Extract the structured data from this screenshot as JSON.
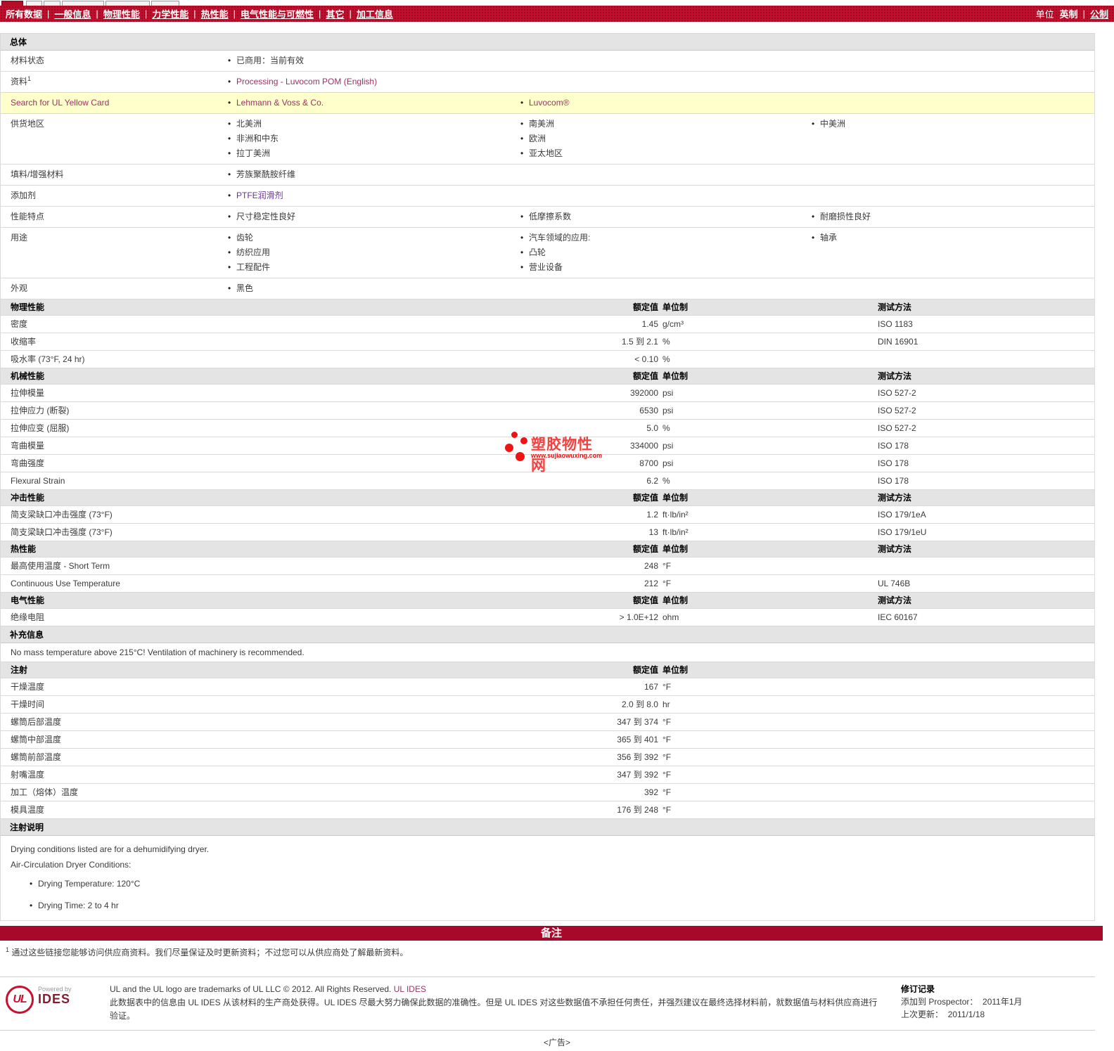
{
  "nav": {
    "tabs": [
      "所有数据",
      "一般信息",
      "物理性能",
      "力学性能",
      "热性能",
      "电气性能与可燃性",
      "其它",
      "加工信息"
    ],
    "units_label": "单位",
    "unit_imperial": "英制",
    "unit_metric": "公制"
  },
  "columns": {
    "value": "额定值",
    "unit": "单位制",
    "method": "测试方法"
  },
  "overview": {
    "title": "总体",
    "material_status": {
      "label": "材料状态",
      "v": "已商用：当前有效"
    },
    "literature": {
      "label": "资料",
      "sup": "1",
      "v": "Processing - Luvocom POM (English)"
    },
    "yellow_card": {
      "label": "Search for UL Yellow Card",
      "supplier": "Lehmann & Voss & Co.",
      "brand": "Luvocom®"
    },
    "availability": {
      "label": "供货地区",
      "c1": [
        "北美洲",
        "非洲和中东",
        "拉丁美洲"
      ],
      "c2": [
        "南美洲",
        "欧洲",
        "亚太地区"
      ],
      "c3": [
        "中美洲"
      ]
    },
    "filler": {
      "label": "填料/增强材料",
      "v": "芳族聚酰胺纤维"
    },
    "additive": {
      "label": "添加剂",
      "v": "PTFE润滑剂"
    },
    "features": {
      "label": "性能特点",
      "c1": [
        "尺寸稳定性良好"
      ],
      "c2": [
        "低摩擦系数"
      ],
      "c3": [
        "耐磨损性良好"
      ]
    },
    "uses": {
      "label": "用途",
      "c1": [
        "齿轮",
        "纺织应用",
        "工程配件"
      ],
      "c2": [
        "汽车领域的应用:",
        "凸轮",
        "营业设备"
      ],
      "c3": [
        "轴承"
      ]
    },
    "appearance": {
      "label": "外观",
      "v": "黑色"
    }
  },
  "physical": {
    "title": "物理性能",
    "rows": [
      {
        "label": "密度",
        "value": "1.45",
        "unit": "g/cm³",
        "method": "ISO 1183"
      },
      {
        "label": "收缩率",
        "value": "1.5 到 2.1",
        "unit": "%",
        "method": "DIN 16901"
      },
      {
        "label": "吸水率  (73°F, 24 hr)",
        "value": "< 0.10",
        "unit": "%",
        "method": ""
      }
    ]
  },
  "mechanical": {
    "title": "机械性能",
    "rows": [
      {
        "label": "拉伸模量",
        "value": "392000",
        "unit": "psi",
        "method": "ISO 527-2"
      },
      {
        "label": "拉伸应力  (断裂)",
        "value": "6530",
        "unit": "psi",
        "method": "ISO 527-2"
      },
      {
        "label": "拉伸应变  (屈服)",
        "value": "5.0",
        "unit": "%",
        "method": "ISO 527-2"
      },
      {
        "label": "弯曲模量",
        "value": "334000",
        "unit": "psi",
        "method": "ISO 178"
      },
      {
        "label": "弯曲强度",
        "value": "8700",
        "unit": "psi",
        "method": "ISO 178"
      },
      {
        "label": "Flexural Strain",
        "value": "6.2",
        "unit": "%",
        "method": "ISO 178"
      }
    ]
  },
  "impact": {
    "title": "冲击性能",
    "rows": [
      {
        "label": "简支梁缺口冲击强度  (73°F)",
        "value": "1.2",
        "unit": "ft·lb/in²",
        "method": "ISO 179/1eA"
      },
      {
        "label": "简支梁缺口冲击强度  (73°F)",
        "value": "13",
        "unit": "ft·lb/in²",
        "method": "ISO 179/1eU"
      }
    ]
  },
  "thermal": {
    "title": "热性能",
    "rows": [
      {
        "label": "最高使用温度  - Short Term",
        "value": "248",
        "unit": "°F",
        "method": ""
      },
      {
        "label": "Continuous Use Temperature",
        "value": "212",
        "unit": "°F",
        "method": "UL 746B"
      }
    ]
  },
  "electrical": {
    "title": "电气性能",
    "rows": [
      {
        "label": "绝缘电阻",
        "value": "> 1.0E+12",
        "unit": "ohm",
        "method": "IEC 60167"
      }
    ]
  },
  "supplemental": {
    "title": "补充信息",
    "text": "No mass temperature above 215°C! Ventilation of machinery is recommended."
  },
  "injection": {
    "title": "注射",
    "rows": [
      {
        "label": "干燥温度",
        "value": "167",
        "unit": "°F"
      },
      {
        "label": "干燥时间",
        "value": "2.0 到 8.0",
        "unit": "hr"
      },
      {
        "label": "螺筒后部温度",
        "value": "347 到 374",
        "unit": "°F"
      },
      {
        "label": "螺筒中部温度",
        "value": "365 到 401",
        "unit": "°F"
      },
      {
        "label": "螺筒前部温度",
        "value": "356 到 392",
        "unit": "°F"
      },
      {
        "label": "射嘴温度",
        "value": "347 到 392",
        "unit": "°F"
      },
      {
        "label": "加工（熔体）温度",
        "value": "392",
        "unit": "°F"
      },
      {
        "label": "模具温度",
        "value": "176 到 248",
        "unit": "°F"
      }
    ]
  },
  "injection_notes": {
    "title": "注射说明",
    "line1": "Drying conditions listed are for a dehumidifying dryer.",
    "line2": "Air-Circulation Dryer Conditions:",
    "bullets": [
      "Drying Temperature: 120°C",
      "Drying Time: 2 to 4 hr"
    ]
  },
  "remarks": {
    "bar": "备注",
    "sup": "1",
    "text": "通过这些链接您能够访问供应商资料。我们尽量保证及时更新资料；不过您可以从供应商处了解最新资料。"
  },
  "watermark": {
    "brand": "塑胶物性网",
    "url": "www.sujiaowuxing.com"
  },
  "footer": {
    "ul": "UL",
    "powered_by": "Powered by",
    "ides": "IDES",
    "trademark": "UL and the UL logo are trademarks of UL LLC © 2012. All Rights Reserved.",
    "trademark_link": "UL IDES",
    "disclaimer": "此数据表中的信息由  UL IDES 从该材料的生产商处获得。UL IDES 尽最大努力确保此数据的准确性。但是  UL IDES 对这些数据值不承担任何责任，并强烈建议在最终选择材料前，就数据值与材料供应商进行验证。",
    "revision_title": "修订记录",
    "added_label": "添加到  Prospector：",
    "added_value": "2011年1月",
    "updated_label": "上次更新：",
    "updated_value": "2011/1/18",
    "ad": "<广告>"
  },
  "colors": {
    "nav_red": "#C00F2D",
    "remark_bar_red": "#A8092A",
    "link_maroon": "#993366",
    "visited_purple": "#663399",
    "yellow_row": "#FFFFCC",
    "section_header_gray": "#E4E4E4",
    "watermark_red": "#EE1414",
    "ul_brand_red": "#C8102E"
  }
}
